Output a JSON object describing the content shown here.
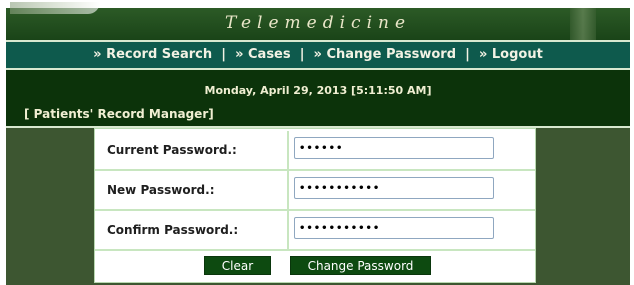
{
  "banner": {
    "title": "Telemedicine"
  },
  "nav": {
    "items": [
      {
        "label": "» Record Search"
      },
      {
        "label": "» Cases"
      },
      {
        "label": "» Change Password"
      },
      {
        "label": "» Logout"
      }
    ],
    "separator": "|"
  },
  "header": {
    "datetime": "Monday, April 29, 2013 [5:11:50 AM]",
    "section_title": "[ Patients' Record Manager]"
  },
  "form": {
    "current_password": {
      "label": "Current Password.:",
      "value": "••••••"
    },
    "new_password": {
      "label": "New Password.:",
      "value": "•••••••••••"
    },
    "confirm_password": {
      "label": "Confirm Password.:",
      "value": "•••••••••••"
    }
  },
  "buttons": {
    "clear": "Clear",
    "change_password": "Change Password"
  },
  "colors": {
    "banner": "#1a4418",
    "navbar": "#0e5a4d",
    "header": "#0c330a",
    "body": "#3d5631",
    "button": "#0d4a10"
  }
}
